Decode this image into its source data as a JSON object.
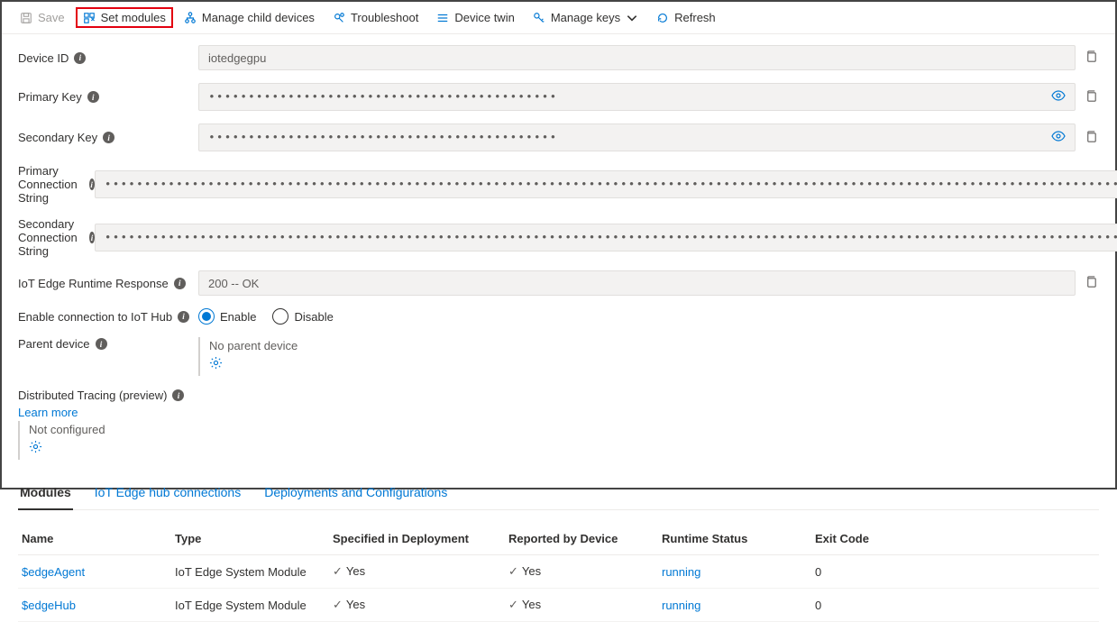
{
  "toolbar": {
    "save": "Save",
    "set_modules": "Set modules",
    "manage_child": "Manage child devices",
    "troubleshoot": "Troubleshoot",
    "device_twin": "Device twin",
    "manage_keys": "Manage keys",
    "refresh": "Refresh"
  },
  "fields": {
    "device_id_label": "Device ID",
    "device_id_value": "iotedgegpu",
    "primary_key_label": "Primary Key",
    "primary_key_value": "••••••••••••••••••••••••••••••••••••••••••••",
    "secondary_key_label": "Secondary Key",
    "secondary_key_value": "••••••••••••••••••••••••••••••••••••••••••••",
    "primary_conn_label": "Primary Connection String",
    "primary_conn_value": "••••••••••••••••••••••••••••••••••••••••••••••••••••••••••••••••••••••••••••••••••••••••••••••••••••••••••••••••••••••••••••••••••••••••",
    "secondary_conn_label": "Secondary Connection String",
    "secondary_conn_value": "••••••••••••••••••••••••••••••••••••••••••••••••••••••••••••••••••••••••••••••••••••••••••••••••••••••••••••••••••••••••••••••••••••••••",
    "runtime_label": "IoT Edge Runtime Response",
    "runtime_value": "200 -- OK",
    "enable_label": "Enable connection to IoT Hub",
    "enable_opt": "Enable",
    "disable_opt": "Disable",
    "parent_label": "Parent device",
    "parent_value": "No parent device",
    "tracing_label": "Distributed Tracing (preview)",
    "learn_more": "Learn more",
    "not_configured": "Not configured"
  },
  "tabs": {
    "modules": "Modules",
    "hub_conn": "IoT Edge hub connections",
    "deployments": "Deployments and Configurations"
  },
  "table": {
    "headers": {
      "name": "Name",
      "type": "Type",
      "spec": "Specified in Deployment",
      "reported": "Reported by Device",
      "status": "Runtime Status",
      "exit": "Exit Code"
    },
    "rows": [
      {
        "name": "$edgeAgent",
        "type": "IoT Edge System Module",
        "spec": "Yes",
        "reported": "Yes",
        "status": "running",
        "exit": "0"
      },
      {
        "name": "$edgeHub",
        "type": "IoT Edge System Module",
        "spec": "Yes",
        "reported": "Yes",
        "status": "running",
        "exit": "0"
      }
    ]
  }
}
